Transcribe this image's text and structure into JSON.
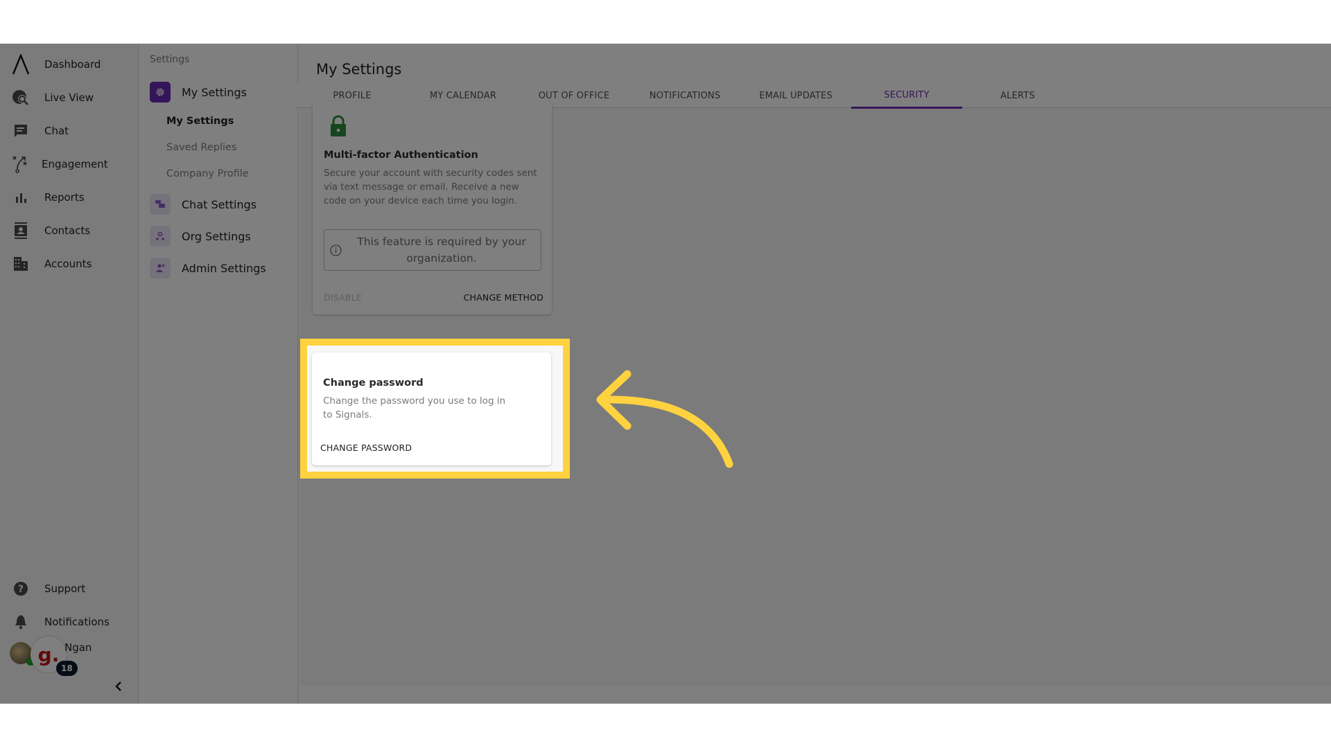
{
  "primary_nav": {
    "items": [
      {
        "label": "Dashboard",
        "icon": "logo-icon"
      },
      {
        "label": "Live View",
        "icon": "live-view-icon"
      },
      {
        "label": "Chat",
        "icon": "chat-icon"
      },
      {
        "label": "Engagement",
        "icon": "engagement-icon"
      },
      {
        "label": "Reports",
        "icon": "reports-icon"
      },
      {
        "label": "Contacts",
        "icon": "contacts-icon"
      },
      {
        "label": "Accounts",
        "icon": "accounts-icon"
      }
    ],
    "bottom_items": [
      {
        "label": "Support",
        "icon": "help-icon"
      },
      {
        "label": "Notifications",
        "icon": "bell-icon"
      }
    ],
    "user": {
      "name": "Ngan",
      "org_initial": "g.",
      "badge_count": "18"
    },
    "collapse_glyph": "‹"
  },
  "settings_nav": {
    "heading": "Settings",
    "groups": [
      {
        "label": "My Settings",
        "active": true,
        "accent": "#6a2bb3",
        "children": [
          {
            "label": "My Settings",
            "active": true
          },
          {
            "label": "Saved Replies",
            "active": false
          },
          {
            "label": "Company Profile",
            "active": false
          }
        ]
      },
      {
        "label": "Chat Settings",
        "active": false
      },
      {
        "label": "Org Settings",
        "active": false
      },
      {
        "label": "Admin Settings",
        "active": false
      }
    ]
  },
  "main": {
    "title": "My Settings",
    "tabs": [
      {
        "label": "PROFILE"
      },
      {
        "label": "MY CALENDAR"
      },
      {
        "label": "OUT OF OFFICE"
      },
      {
        "label": "NOTIFICATIONS"
      },
      {
        "label": "EMAIL UPDATES"
      },
      {
        "label": "SECURITY"
      },
      {
        "label": "ALERTS"
      }
    ],
    "active_tab": "SECURITY",
    "accent_color": "#6a2bb3",
    "mfa_card": {
      "title": "Multi-factor Authentication",
      "description": "Secure your account with security codes sent via text message or email. Receive a new code on your device each time you login.",
      "notice": "This feature is required by your organization.",
      "disable_label": "DISABLE",
      "change_method_label": "CHANGE METHOD",
      "lock_color": "#2e8b3a"
    },
    "password_card": {
      "title": "Change password",
      "description": "Change the password you use to log in to Signals.",
      "button_label": "CHANGE PASSWORD"
    }
  },
  "annotation": {
    "highlight_color": "#ffd23f",
    "target": "change-password-card"
  }
}
